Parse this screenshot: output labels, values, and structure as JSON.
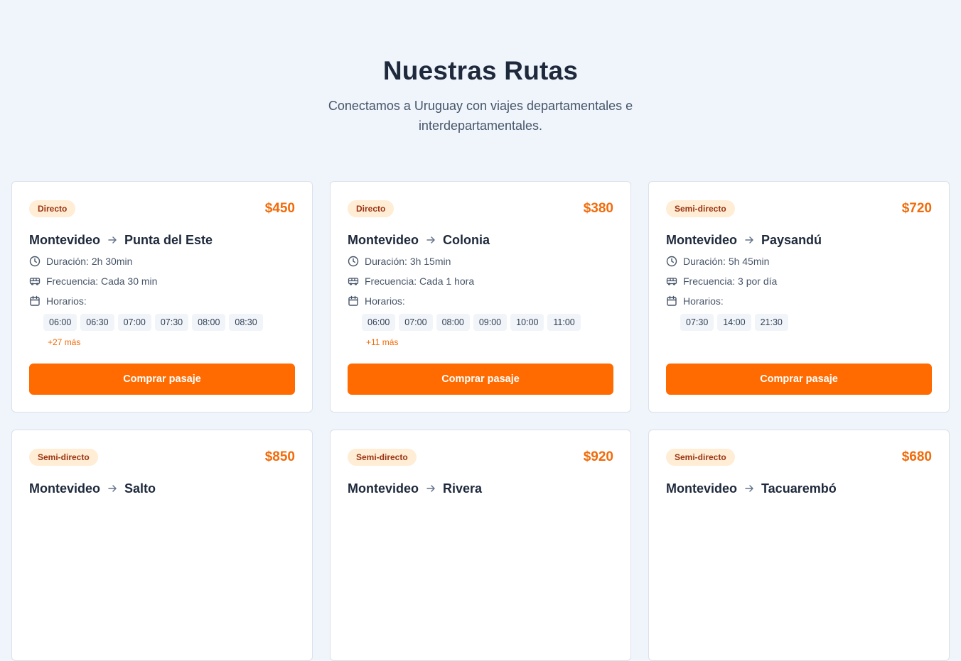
{
  "header": {
    "title": "Nuestras Rutas",
    "subtitle": "Conectamos a Uruguay con viajes departamentales e interdepartamentales."
  },
  "colors": {
    "accent": "#ff6b00",
    "price": "#f26b0a",
    "badge_bg": "#ffedd5",
    "badge_text": "#9a3412"
  },
  "icons": {
    "duration": "clock-icon",
    "frequency": "bus-icon",
    "schedule": "calendar-icon",
    "route": "arrow-right-icon"
  },
  "labels": {
    "duration": "Duración:",
    "frequency": "Frecuencia:",
    "schedule": "Horarios:"
  },
  "routes": [
    {
      "badge": "Directo",
      "price": "$450",
      "origin": "Montevideo",
      "destination": "Punta del Este",
      "duration": "2h 30min",
      "frequency": "Cada 30 min",
      "times": [
        "06:00",
        "06:30",
        "07:00",
        "07:30",
        "08:00",
        "08:30"
      ],
      "more": "+27 más",
      "button": "Comprar pasaje"
    },
    {
      "badge": "Directo",
      "price": "$380",
      "origin": "Montevideo",
      "destination": "Colonia",
      "duration": "3h 15min",
      "frequency": "Cada 1 hora",
      "times": [
        "06:00",
        "07:00",
        "08:00",
        "09:00",
        "10:00",
        "11:00"
      ],
      "more": "+11 más",
      "button": "Comprar pasaje"
    },
    {
      "badge": "Semi-directo",
      "price": "$720",
      "origin": "Montevideo",
      "destination": "Paysandú",
      "duration": "5h 45min",
      "frequency": "3 por día",
      "times": [
        "07:30",
        "14:00",
        "21:30"
      ],
      "more": "",
      "button": "Comprar pasaje"
    },
    {
      "badge": "Semi-directo",
      "price": "$850",
      "origin": "Montevideo",
      "destination": "Salto",
      "duration": "",
      "frequency": "",
      "times": [],
      "more": "",
      "button": ""
    },
    {
      "badge": "Semi-directo",
      "price": "$920",
      "origin": "Montevideo",
      "destination": "Rivera",
      "duration": "",
      "frequency": "",
      "times": [],
      "more": "",
      "button": ""
    },
    {
      "badge": "Semi-directo",
      "price": "$680",
      "origin": "Montevideo",
      "destination": "Tacuarembó",
      "duration": "",
      "frequency": "",
      "times": [],
      "more": "",
      "button": ""
    }
  ]
}
